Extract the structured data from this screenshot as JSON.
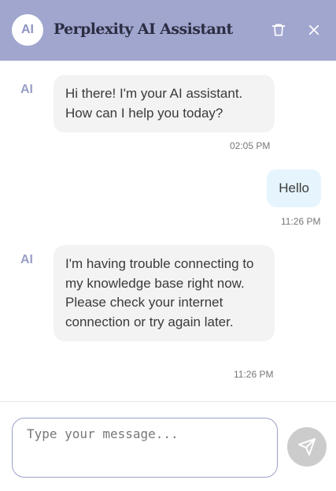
{
  "header": {
    "avatar_text": "AI",
    "title": "Perplexity AI Assistant",
    "background": "#a1a6cf",
    "icons": {
      "clear": "trash-icon",
      "close": "close-icon"
    }
  },
  "messages": [
    {
      "sender": "ai",
      "label": "AI",
      "text": "Hi there! I'm your AI assistant. How can I help you today?",
      "time": "02:05 PM"
    },
    {
      "sender": "user",
      "text": "Hello",
      "time": "11:26 PM"
    },
    {
      "sender": "ai",
      "label": "AI",
      "text": "I'm having trouble connecting to my knowledge base right now. Please check your internet connection or try again later.",
      "time": "11:26 PM"
    }
  ],
  "composer": {
    "placeholder": "Type your message...",
    "value": "",
    "send_icon": "send-icon"
  }
}
